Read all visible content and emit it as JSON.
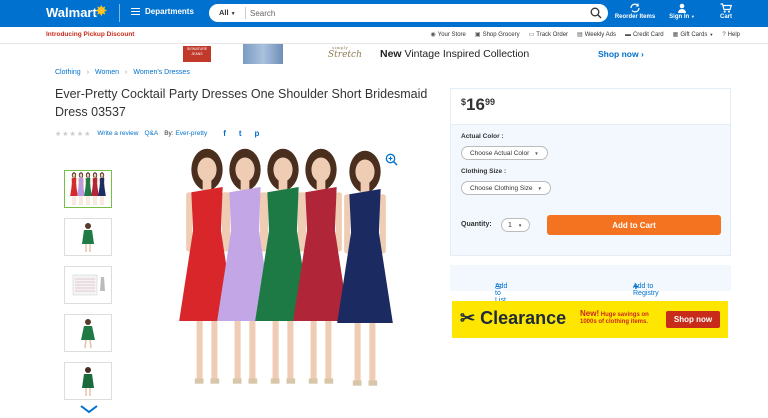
{
  "header": {
    "logo": "Walmart",
    "departments_label": "Departments",
    "search_scope": "All",
    "search_placeholder": "Search",
    "reorder_label": "Reorder Items",
    "signin_label": "Sign In",
    "cart_label": "Cart"
  },
  "subheader": {
    "promo": "Introducing Pickup Discount",
    "links": [
      "Your Store",
      "Shop Grocery",
      "Track Order",
      "Weekly Ads",
      "Credit Card",
      "Gift Cards",
      "Help"
    ]
  },
  "banner": {
    "signature_text": "SIGNATURE JEANS",
    "stretch_top": "simply",
    "stretch_word": "Stretch",
    "headline_bold": "New",
    "headline_rest": "Vintage Inspired Collection",
    "cta": "Shop now ›"
  },
  "breadcrumb": [
    "Clothing",
    "Women",
    "Women's Dresses"
  ],
  "product": {
    "title": "Ever-Pretty Cocktail Party Dresses One Shoulder Short Bridesmaid Dress 03537",
    "write_review": "Write a review",
    "qa": "Q&A",
    "by_label": "By:",
    "brand": "Ever-pretty",
    "stars": "★★★★★",
    "social": [
      "f",
      "t",
      "p"
    ]
  },
  "thumbnails": [
    {
      "name": "group",
      "colors": [
        "#d42a2a",
        "#b99ae0",
        "#1f7a45",
        "#b3263a",
        "#1f2c60"
      ]
    },
    {
      "name": "green-front",
      "colors": [
        "#1f7a45"
      ]
    },
    {
      "name": "size-chart",
      "colors": []
    },
    {
      "name": "green-side",
      "colors": [
        "#1f7a45"
      ]
    },
    {
      "name": "green-back",
      "colors": [
        "#1f7a45"
      ]
    }
  ],
  "main_image": {
    "dress_colors": [
      "#d8262b",
      "#c3a6e6",
      "#1e7a44",
      "#b02538",
      "#1c2a62"
    ]
  },
  "buybox": {
    "currency": "$",
    "price_whole": "16",
    "price_cents": "99",
    "color_label": "Actual Color :",
    "color_select": "Choose Actual Color",
    "size_label": "Clothing Size :",
    "size_select": "Choose Clothing Size",
    "qty_label": "Quantity:",
    "qty_value": "1",
    "add_to_cart": "Add to Cart"
  },
  "lists": {
    "add_list": "Add to List",
    "add_registry": "Add to Registry"
  },
  "clearance": {
    "word": "Clearance",
    "new": "New!",
    "sub1": "Huge savings on",
    "sub2": "1000s of clothing items.",
    "cta": "Shop now"
  },
  "colors": {
    "brand_blue": "#0071ce",
    "spark_yellow": "#ffc220",
    "cart_orange": "#f47321",
    "clearance_yellow": "#ffe600",
    "clearance_red": "#c82b1a"
  }
}
